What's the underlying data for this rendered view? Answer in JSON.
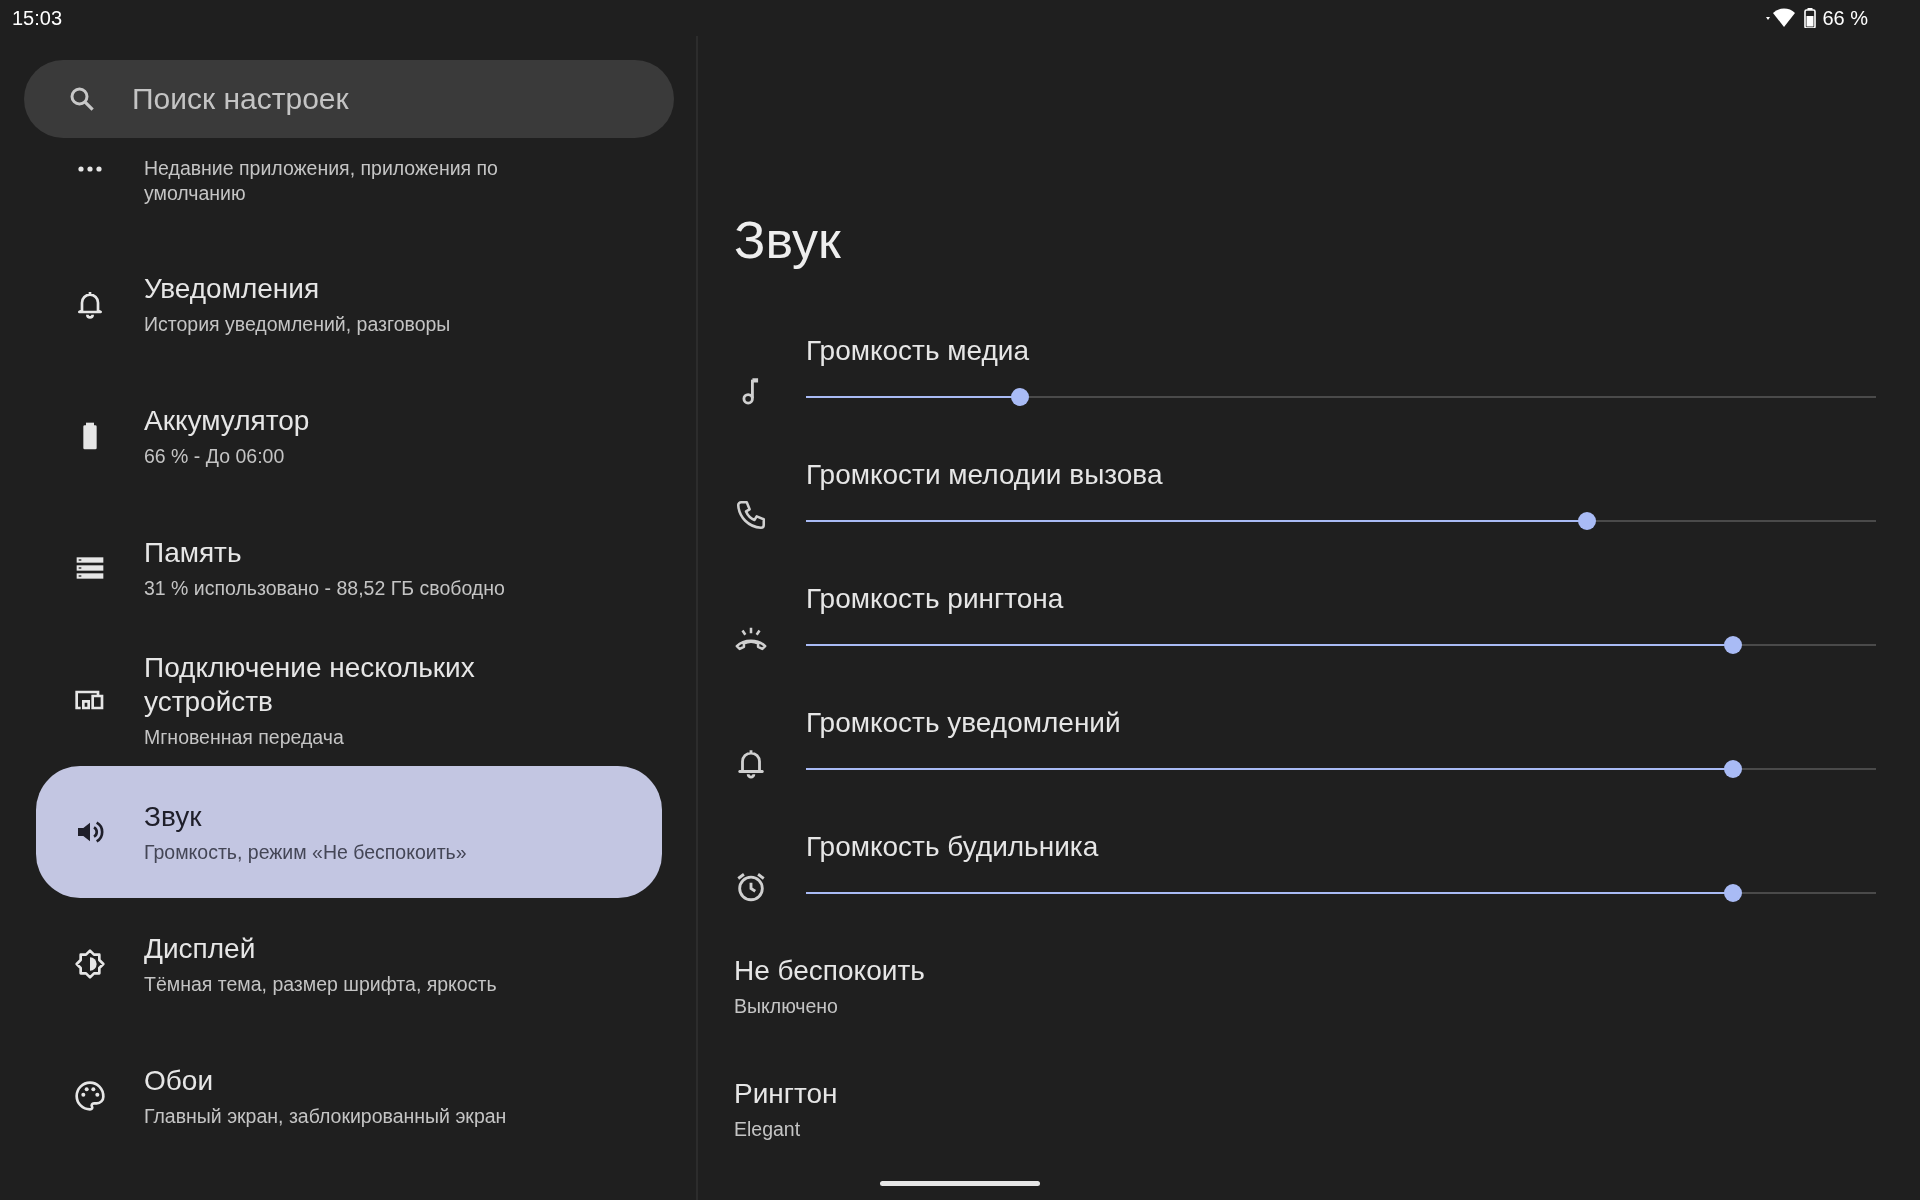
{
  "status_bar": {
    "time": "15:03",
    "battery": "66 %"
  },
  "search": {
    "placeholder": "Поиск настроек"
  },
  "sidebar": {
    "items": [
      {
        "subtitle": "Недавние приложения, приложения по умолчанию",
        "selected": false
      },
      {
        "title": "Уведомления",
        "subtitle": "История уведомлений, разговоры",
        "selected": false
      },
      {
        "title": "Аккумулятор",
        "subtitle": "66 % - До 06:00",
        "selected": false
      },
      {
        "title": "Память",
        "subtitle": "31 % использовано - 88,52 ГБ свободно",
        "selected": false
      },
      {
        "title": "Подключение нескольких устройств",
        "subtitle": "Мгновенная передача",
        "selected": false
      },
      {
        "title": "Звук",
        "subtitle": "Громкость, режим «Не беспокоить»",
        "selected": true
      },
      {
        "title": "Дисплей",
        "subtitle": "Тёмная тема, размер шрифта, яркость",
        "selected": false
      },
      {
        "title": "Обои",
        "subtitle": "Главный экран, заблокированный экран",
        "selected": false
      }
    ]
  },
  "page": {
    "title": "Звук",
    "sliders": [
      {
        "label": "Громкость медиа",
        "level": 0.2
      },
      {
        "label": "Громкости мелодии вызова",
        "level": 0.73
      },
      {
        "label": "Громкость рингтона",
        "level": 0.866
      },
      {
        "label": "Громкость уведомлений",
        "level": 0.866
      },
      {
        "label": "Громкость будильника",
        "level": 0.866
      }
    ],
    "settings": [
      {
        "title": "Не беспокоить",
        "subtitle": "Выключено"
      },
      {
        "title": "Рингтон",
        "subtitle": "Elegant"
      }
    ]
  }
}
